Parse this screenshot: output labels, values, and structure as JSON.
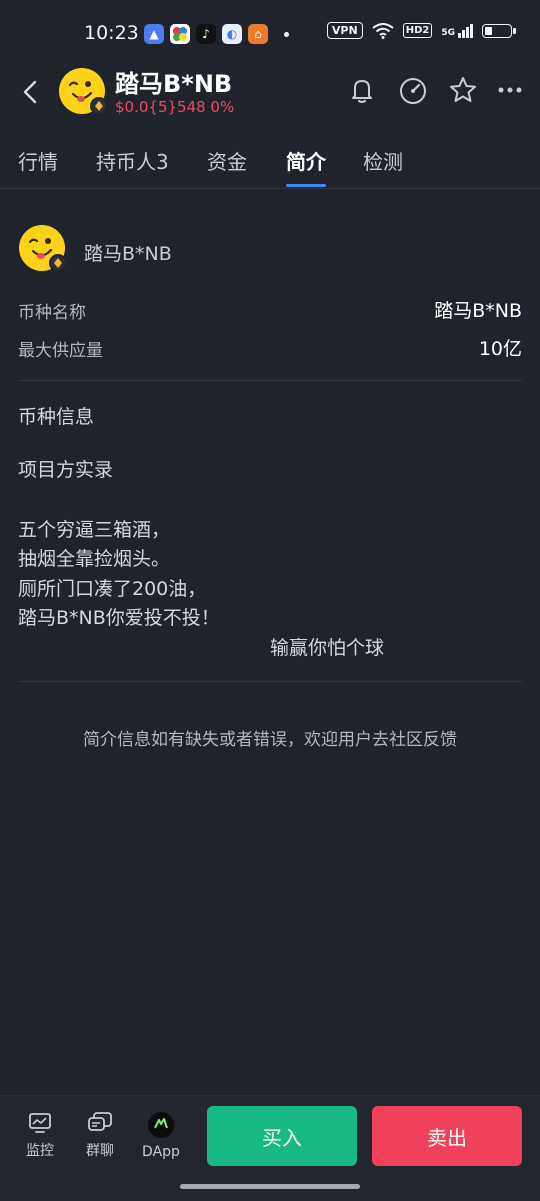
{
  "status_bar": {
    "time": "10:23",
    "vpn": "VPN",
    "hd": "HD2",
    "network": "5G",
    "battery_level": 0.3
  },
  "header": {
    "title": "踏马B*NB",
    "price": "$0.0{5}548 0%",
    "icons": [
      "back-icon",
      "bell-icon",
      "gauge-icon",
      "star-icon",
      "more-icon"
    ]
  },
  "tabs": [
    {
      "label": "行情",
      "active": false
    },
    {
      "label": "持币人3",
      "active": false
    },
    {
      "label": "资金",
      "active": false
    },
    {
      "label": "简介",
      "active": true
    },
    {
      "label": "检测",
      "active": false
    }
  ],
  "coin": {
    "name": "踏马B*NB"
  },
  "fields": [
    {
      "label": "币种名称",
      "value": "踏马B*NB"
    },
    {
      "label": "最大供应量",
      "value": "10亿"
    }
  ],
  "info": {
    "section_title": "币种信息",
    "subtitle": "项目方实录",
    "lines": [
      "五个穷逼三箱酒，",
      "抽烟全靠捡烟头。",
      "厕所门口凑了200油，",
      "踏马B*NB你爱投不投！"
    ],
    "closing": "输赢你怕个球"
  },
  "feedback": "简介信息如有缺失或者错误，欢迎用户去社区反馈",
  "bottom_nav": [
    {
      "label": "监控",
      "icon": "monitor-icon"
    },
    {
      "label": "群聊",
      "icon": "chat-icon"
    },
    {
      "label": "DApp",
      "icon": "dapp-icon"
    }
  ],
  "actions": {
    "buy": "买入",
    "sell": "卖出"
  },
  "colors": {
    "background": "#1f232b",
    "price_red": "#f2495f",
    "tab_accent": "#3f86f7",
    "buy_green": "#17b883",
    "sell_red": "#f0415c"
  }
}
